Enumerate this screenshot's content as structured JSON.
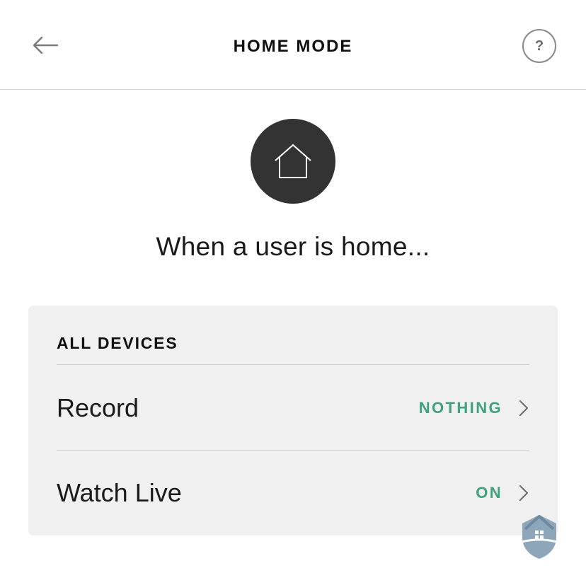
{
  "header": {
    "title": "HOME MODE",
    "back_icon": "arrow-left-icon",
    "help_label": "?"
  },
  "mode": {
    "icon": "house-outline-icon",
    "description": "When a user is home..."
  },
  "devices": {
    "section_title": "ALL DEVICES",
    "rows": [
      {
        "label": "Record",
        "value": "NOTHING"
      },
      {
        "label": "Watch Live",
        "value": "ON"
      }
    ]
  },
  "colors": {
    "accent_green": "#3fa27f",
    "icon_circle": "#333333",
    "card_bg": "#f0f0f0"
  }
}
